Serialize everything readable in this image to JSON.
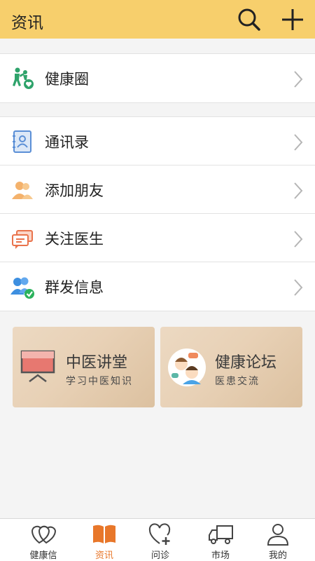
{
  "header": {
    "title": "资讯",
    "search_icon": "search-icon",
    "add_icon": "plus-icon"
  },
  "menu_top": [
    {
      "label": "健康圈",
      "icon": "health-circle-icon"
    }
  ],
  "menu_main": [
    {
      "label": "通讯录",
      "icon": "contacts-icon"
    },
    {
      "label": "添加朋友",
      "icon": "add-friend-icon"
    },
    {
      "label": "关注医生",
      "icon": "follow-doctor-icon"
    },
    {
      "label": "群发信息",
      "icon": "group-message-icon"
    }
  ],
  "cards": {
    "left": {
      "title": "中医讲堂",
      "subtitle": "学习中医知识",
      "icon": "tv-icon"
    },
    "right": {
      "title": "健康论坛",
      "subtitle": "医患交流",
      "icon": "doctor-patient-icon"
    }
  },
  "tabbar": [
    {
      "label": "健康信",
      "icon": "heart-icon",
      "active": false
    },
    {
      "label": "资讯",
      "icon": "book-icon",
      "active": true
    },
    {
      "label": "问诊",
      "icon": "heart-plus-icon",
      "active": false
    },
    {
      "label": "市场",
      "icon": "truck-icon",
      "active": false
    },
    {
      "label": "我的",
      "icon": "person-icon",
      "active": false
    }
  ],
  "colors": {
    "header_bg": "#f7cf6c",
    "active_tab": "#e8772a"
  }
}
